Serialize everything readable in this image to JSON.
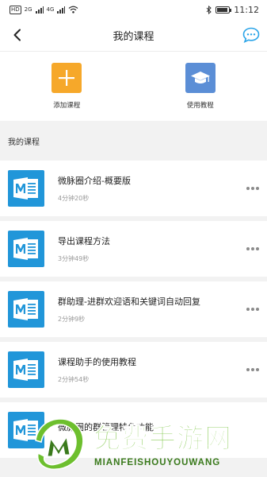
{
  "status_bar": {
    "left_badge": "HD",
    "left_signal_1": "2G",
    "left_signal_2": "4G",
    "time": "11:12"
  },
  "nav": {
    "title": "我的课程",
    "back_icon": "chevron-left-icon",
    "chat_icon": "chat-bubble-icon"
  },
  "quick_actions": [
    {
      "label": "添加课程",
      "icon": "plus-icon",
      "color": "#f6a82a"
    },
    {
      "label": "使用教程",
      "icon": "graduation-cap-icon",
      "color": "#5b8ed6"
    }
  ],
  "section": {
    "title": "我的课程"
  },
  "courses": [
    {
      "title": "微脉圈介绍-概要版",
      "duration": "4分钟20秒"
    },
    {
      "title": "导出课程方法",
      "duration": "3分钟49秒"
    },
    {
      "title": "群助理-进群欢迎语和关键词自动回复",
      "duration": "2分钟9秒"
    },
    {
      "title": "课程助手的使用教程",
      "duration": "2分钟54秒"
    },
    {
      "title": "微脉圈的群管理特色功能",
      "duration": ""
    }
  ],
  "watermark": {
    "cn": "免费手游网",
    "en": "MIANFEISHOUYOUWANG"
  },
  "colors": {
    "accent_blue": "#2196d9",
    "chat_icon": "#2aa4e8"
  }
}
